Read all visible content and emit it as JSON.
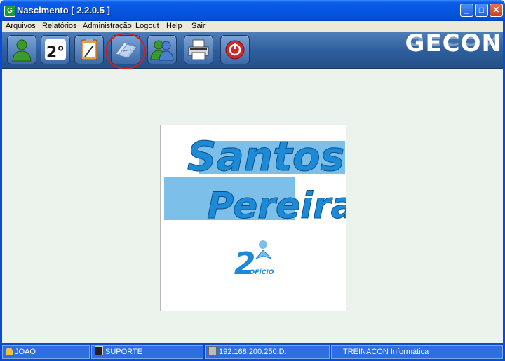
{
  "window": {
    "title": "Nascimento [ 2.2.0.5 ]"
  },
  "menu": [
    "Arquivos",
    "Relatórios",
    "Administração",
    "Logout",
    "Help",
    "Sair"
  ],
  "toolbar": {
    "buttons": [
      {
        "icon": "user-icon"
      },
      {
        "icon": "second-office-icon",
        "label": "2°"
      },
      {
        "icon": "clipboard-search-icon"
      },
      {
        "icon": "documents-icon"
      },
      {
        "icon": "users-icon"
      },
      {
        "icon": "printer-icon"
      },
      {
        "icon": "power-icon"
      }
    ],
    "brand": "GECON"
  },
  "logo": {
    "line1": "Santos",
    "line2": "Pereira",
    "badge": "2",
    "badge_sub": "OFÍCIO"
  },
  "statusbar": {
    "user": "JOAO",
    "profile": "SUPORTE",
    "server": "192.168.200.250:D:",
    "company": "TREINACON Informática"
  },
  "colors": {
    "titlebar": "#0a5ce8",
    "toolbar": "#2d5e9c",
    "logo_blue": "#1d8ad8",
    "logo_band": "#7cc0ea",
    "highlight": "#d02020"
  }
}
